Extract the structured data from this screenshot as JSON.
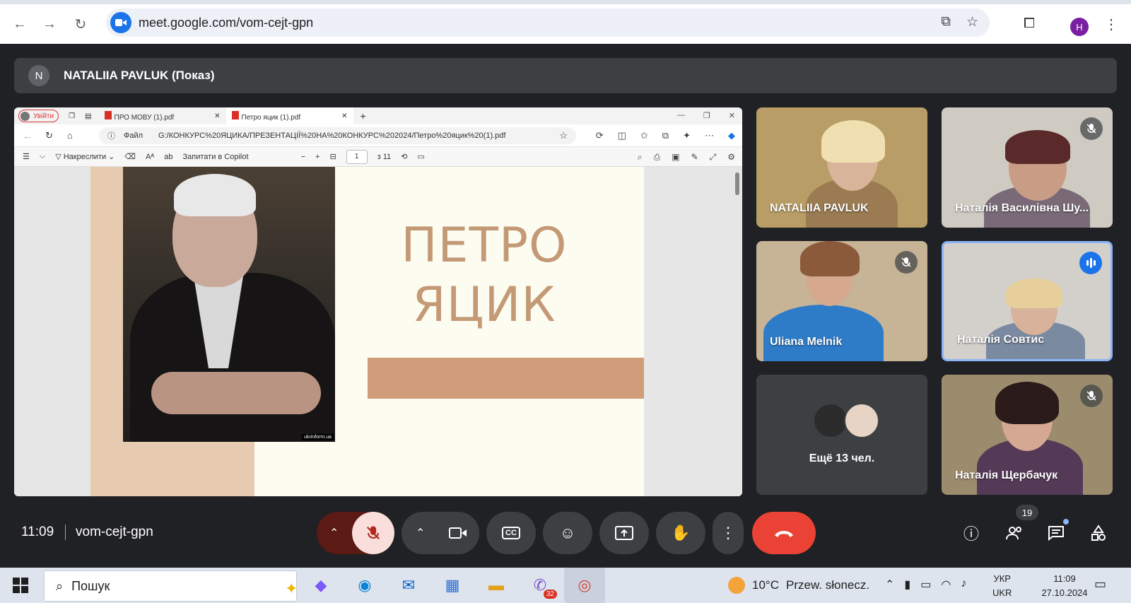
{
  "browser": {
    "url": "meet.google.com/vom-cejt-gpn",
    "profile_initial": "H"
  },
  "banner": {
    "avatar_initial": "N",
    "title": "NATALIIA PAVLUK (Показ)"
  },
  "shared_screen": {
    "signin_label": "Увійти",
    "tabs": [
      {
        "label": "ПРО МОВУ (1).pdf"
      },
      {
        "label": "Петро яцик (1).pdf"
      }
    ],
    "address_prefix": "Файл",
    "address": "G:/КОНКУРС%20ЯЦИКА/ПРЕЗЕНТАЦІЇ%20НА%20КОНКУРС%202024/Петро%20яцик%20(1).pdf",
    "toolbar": {
      "draw_label": "Накреслити",
      "copilot_label": "Запитати в Copilot",
      "page_current": "1",
      "page_total": "з 11"
    },
    "slide": {
      "title_line1": "ПЕТРО",
      "title_line2": "ЯЦИК",
      "photo_credit": "ukrinform.ua"
    }
  },
  "participants": [
    {
      "name": "NATALIIA PAVLUK",
      "muted": false
    },
    {
      "name": "Наталія Василівна Шу...",
      "muted": true
    },
    {
      "name": "Uliana Melnik",
      "muted": true
    },
    {
      "name": "Наталія Совтис",
      "speaking": true
    },
    {
      "name": "Наталія Щербачук",
      "muted": true
    }
  ],
  "more_tile": {
    "label": "Ещё 13 чел."
  },
  "controls": {
    "time": "11:09",
    "meeting_code": "vom-cejt-gpn",
    "participants_count": "19"
  },
  "taskbar": {
    "search_placeholder": "Пошук",
    "viber_badge": "32",
    "weather_temp": "10°C",
    "weather_desc": "Przew. słonecz.",
    "lang_top": "УКР",
    "lang_bottom": "UKR",
    "clock_time": "11:09",
    "clock_date": "27.10.2024"
  },
  "colors": {
    "meet_bg": "#202124",
    "tile_bg": "#3c4043",
    "end_call": "#ea4335",
    "mic_off_bg": "#f9dedc",
    "speaking_border": "#8ab4f8",
    "slide_accent": "#cf9d7a"
  }
}
